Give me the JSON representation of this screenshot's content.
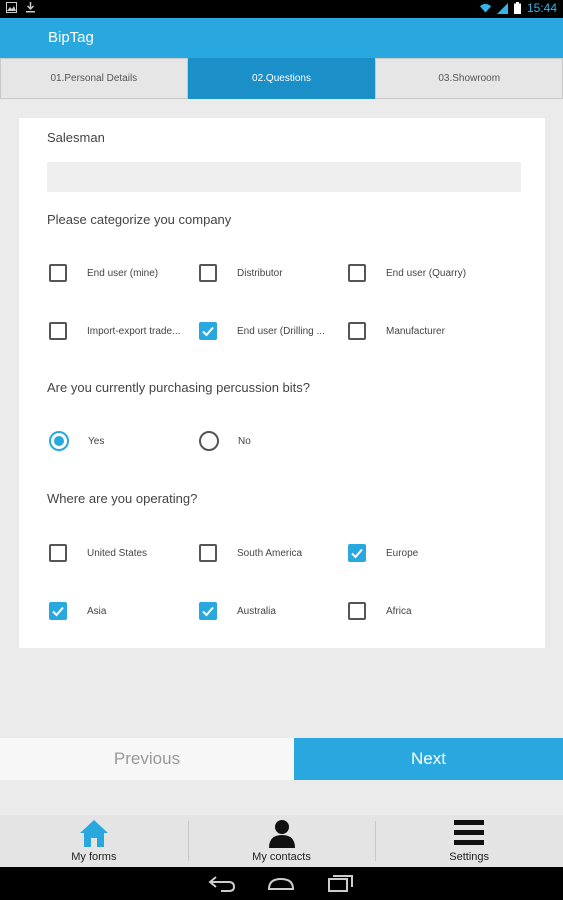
{
  "status_bar": {
    "time": "15:44"
  },
  "app": {
    "title": "BipTag"
  },
  "tabs": [
    {
      "label": "01.Personal Details",
      "active": false
    },
    {
      "label": "02.Questions",
      "active": true
    },
    {
      "label": "03.Showroom",
      "active": false
    }
  ],
  "form": {
    "salesman_label": "Salesman",
    "salesman_value": "",
    "categorize_label": "Please categorize you company",
    "categories": [
      {
        "label": "End user (mine)",
        "checked": false
      },
      {
        "label": "Distributor",
        "checked": false
      },
      {
        "label": "End user (Quarry)",
        "checked": false
      },
      {
        "label": "Import-export trade...",
        "checked": false
      },
      {
        "label": "End user (Drilling ...",
        "checked": true
      },
      {
        "label": "Manufacturer",
        "checked": false
      }
    ],
    "purchasing_label": "Are you currently purchasing percussion bits?",
    "purchasing_options": [
      {
        "label": "Yes",
        "selected": true
      },
      {
        "label": "No",
        "selected": false
      }
    ],
    "operating_label": "Where are you operating?",
    "regions": [
      {
        "label": "United States",
        "checked": false
      },
      {
        "label": "South America",
        "checked": false
      },
      {
        "label": "Europe",
        "checked": true
      },
      {
        "label": "Asia",
        "checked": true
      },
      {
        "label": "Australia",
        "checked": true
      },
      {
        "label": "Africa",
        "checked": false
      }
    ]
  },
  "buttons": {
    "previous": "Previous",
    "next": "Next"
  },
  "bottom_nav": [
    {
      "label": "My forms",
      "icon": "home-icon"
    },
    {
      "label": "My contacts",
      "icon": "person-icon"
    },
    {
      "label": "Settings",
      "icon": "menu-icon"
    }
  ],
  "colors": {
    "accent": "#29a8e0",
    "active_tab": "#1a8fc8"
  }
}
